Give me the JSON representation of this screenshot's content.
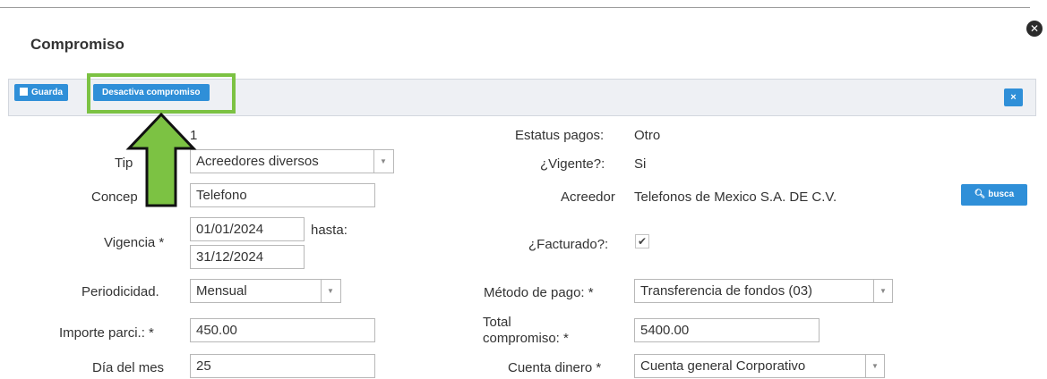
{
  "dialog": {
    "title": "Compromiso",
    "close_icon": "close-circle-icon"
  },
  "toolbar": {
    "guarda_label": "Guarda",
    "desactiva_label": "Desactiva compromiso",
    "close_label": "×",
    "highlight_color": "#7cc243",
    "button_color": "#2f8fd8"
  },
  "form": {
    "id_value": "1",
    "tipo_label": "Tip",
    "tipo_value": "Acreedores diversos",
    "concepto_label": "Concep",
    "concepto_value": "Telefono",
    "vigencia_label": "Vigencia *",
    "vigencia_desde": "01/01/2024",
    "hasta_label": "hasta:",
    "vigencia_hasta": "31/12/2024",
    "periodicidad_label": "Periodicidad.",
    "periodicidad_value": "Mensual",
    "importe_label": "Importe parci.: *",
    "importe_value": "450.00",
    "dia_label": "Día del mes",
    "dia_value": "25",
    "estatus_label": "Estatus pagos:",
    "estatus_value": "Otro",
    "vigente_label": "¿Vigente?:",
    "vigente_value": "Si",
    "acreedor_label": "Acreedor",
    "acreedor_value": "Telefonos de Mexico S.A. DE C.V.",
    "busca_label": "busca",
    "facturado_label": "¿Facturado?:",
    "facturado_checked": "✔",
    "metodo_label": "Método de pago:  *",
    "metodo_value": "Transferencia de fondos (03)",
    "total_label_1": "Total",
    "total_label_2": "compromiso: *",
    "total_value": "5400.00",
    "cuenta_label": "Cuenta dinero  *",
    "cuenta_value": "Cuenta general Corporativo"
  }
}
